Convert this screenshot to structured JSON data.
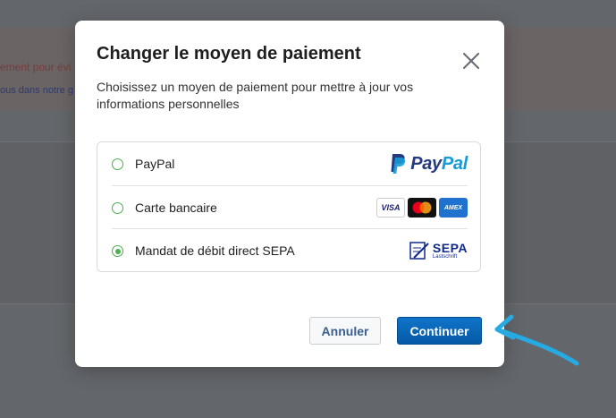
{
  "background": {
    "alert_line1": "ement pour évi",
    "alert_line2": "ous dans notre g"
  },
  "modal": {
    "title": "Changer le moyen de paiement",
    "description": "Choisissez un moyen de paiement pour mettre à jour vos informations personnelles",
    "options": [
      {
        "label": "PayPal",
        "selected": false,
        "logo": "paypal-logo"
      },
      {
        "label": "Carte bancaire",
        "selected": false,
        "logo": "card-logos"
      },
      {
        "label": "Mandat de débit direct SEPA",
        "selected": true,
        "logo": "sepa-logo"
      }
    ],
    "paypal_logo": {
      "pay": "Pay",
      "pal": "Pal"
    },
    "cards": {
      "visa": "VISA",
      "amex": "AMEX"
    },
    "sepa_logo": {
      "big": "SEPA",
      "small": "Lastschrift"
    },
    "buttons": {
      "cancel": "Annuler",
      "continue": "Continuer"
    }
  },
  "colors": {
    "overlay": "#63666a",
    "accent": "#0a66b5",
    "radio": "#4caf50",
    "arrow": "#27a9e1"
  }
}
